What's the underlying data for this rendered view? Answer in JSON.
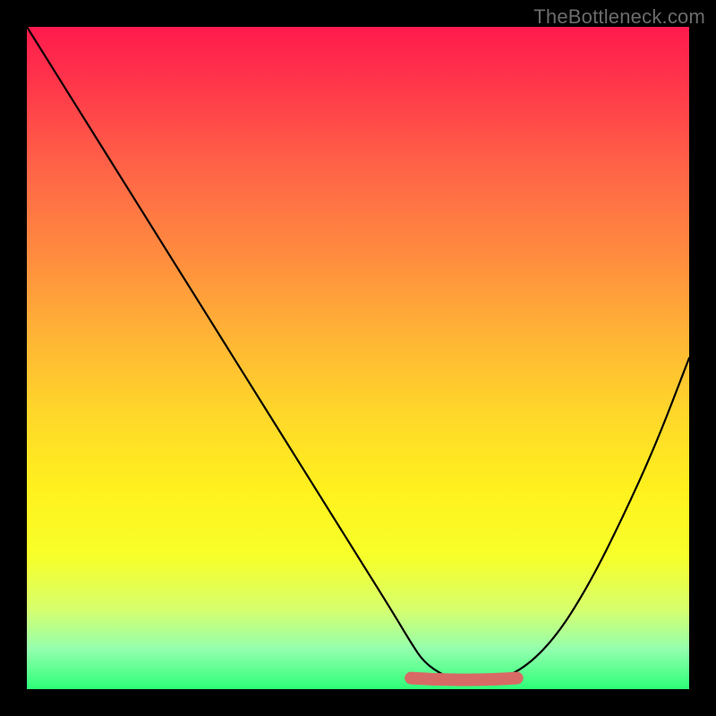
{
  "watermark": "TheBottleneck.com",
  "colors": {
    "background": "#000000",
    "gradient_top": "#ff1a4d",
    "gradient_bottom": "#2dff78",
    "curve": "#000000",
    "valley_marker": "#d86a66"
  },
  "chart_data": {
    "type": "line",
    "title": "",
    "xlabel": "",
    "ylabel": "",
    "xlim": [
      0,
      100
    ],
    "ylim": [
      0,
      100
    ],
    "x": [
      0,
      5,
      10,
      15,
      20,
      25,
      30,
      35,
      40,
      45,
      50,
      55,
      58,
      60,
      63,
      66,
      70,
      75,
      80,
      85,
      90,
      95,
      100
    ],
    "series": [
      {
        "name": "bottleneck-curve",
        "values": [
          100,
          92,
          84,
          76,
          68,
          60,
          52,
          44,
          36,
          28,
          20,
          12,
          7,
          4,
          2,
          1,
          1,
          3,
          8,
          16,
          26,
          37,
          50
        ]
      }
    ],
    "annotations": [
      {
        "name": "optimal-range",
        "x_start": 58,
        "x_end": 74,
        "y": 1
      }
    ]
  }
}
